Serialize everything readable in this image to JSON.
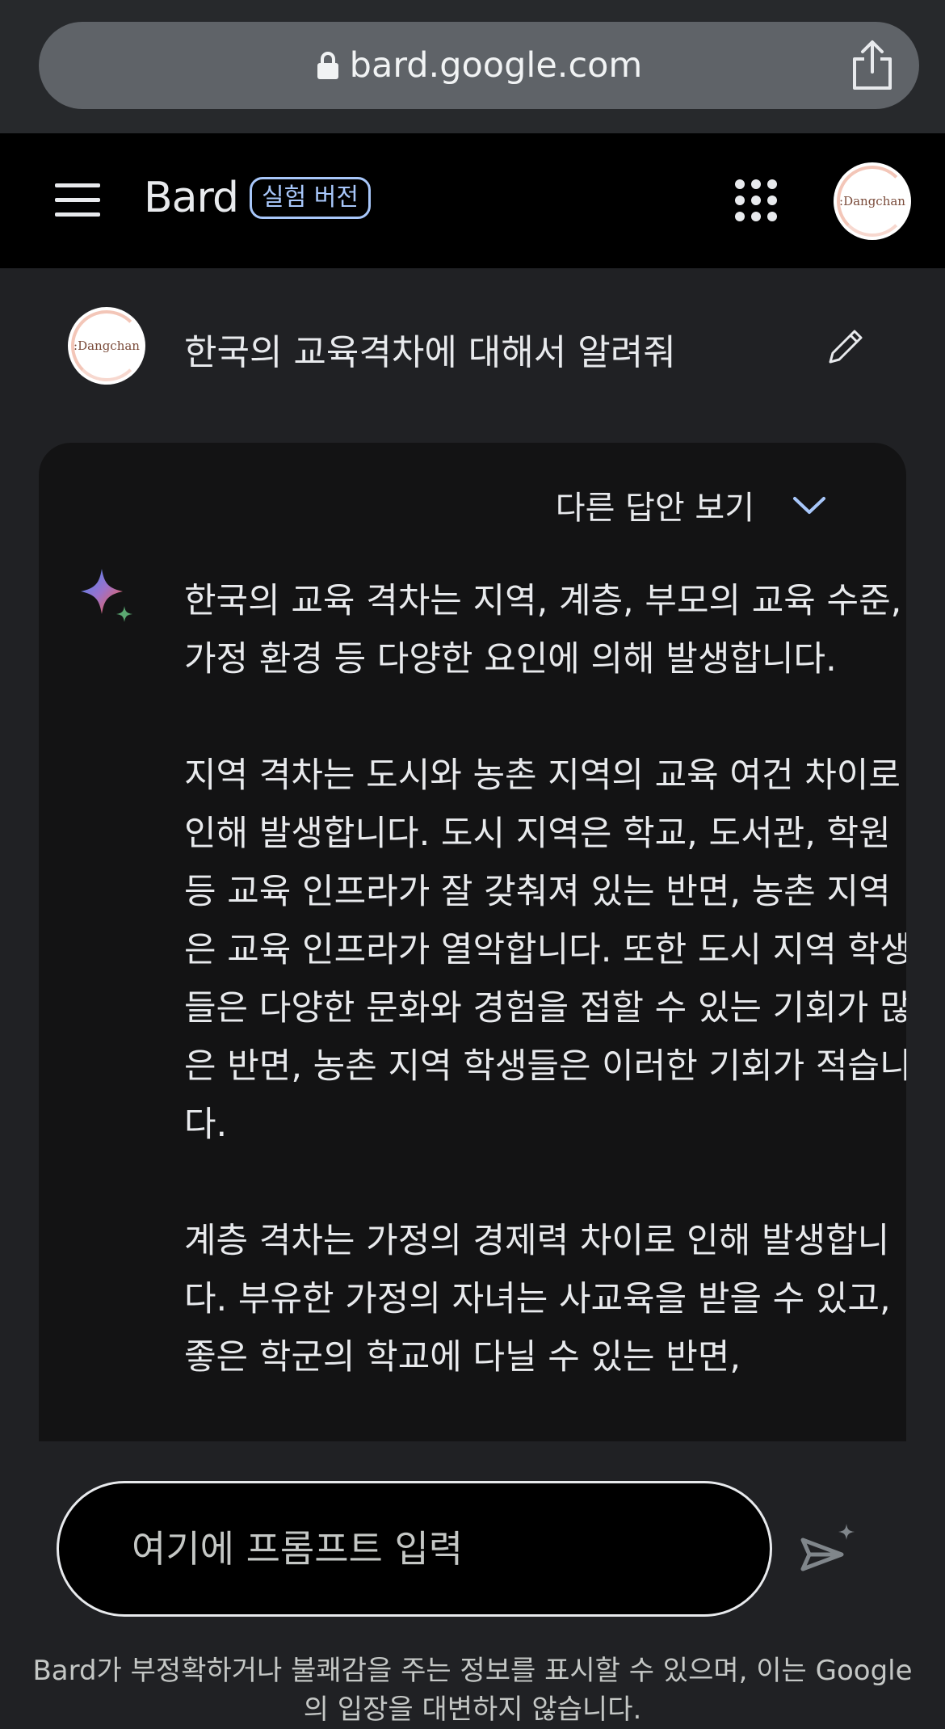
{
  "browser": {
    "url": "bard.google.com",
    "icons": {
      "lock": "lock-icon",
      "share": "share-icon"
    }
  },
  "header": {
    "brand": "Bard",
    "badge": "실험 버전",
    "icons": {
      "menu": "hamburger-menu-icon",
      "apps": "apps-grid-icon"
    },
    "avatar_label": ":Dangchan"
  },
  "conversation": {
    "user_avatar_label": ":Dangchan",
    "user_prompt": "한국의 교육격차에 대해서 알려줘",
    "drafts_label": "다른 답안 보기",
    "response_paragraphs": [
      "한국의 교육 격차는 지역, 계층, 부모의 교육 수준, 가정 환경 등 다양한 요인에 의해 발생합니다.",
      "지역 격차는 도시와 농촌 지역의 교육 여건 차이로 인해 발생합니다. 도시 지역은 학교, 도서관, 학원 등 교육 인프라가 잘 갖춰져 있는 반면, 농촌 지역은 교육 인프라가 열악합니다. 또한 도시 지역 학생들은 다양한 문화와 경험을 접할 수 있는 기회가 많은 반면, 농촌 지역 학생들은 이러한 기회가 적습니다.",
      "계층 격차는 가정의 경제력 차이로 인해 발생합니다. 부유한 가정의 자녀는 사교육을 받을 수 있고, 좋은 학군의 학교에 다닐 수 있는 반면,"
    ]
  },
  "input": {
    "placeholder": "여기에 프롬프트 입력",
    "disclaimer": "Bard가 부정확하거나 불쾌감을 주는 정보를 표시할 수 있으며, 이는 Google의 입장을 대변하지 않습니다."
  },
  "colors": {
    "background": "#202124",
    "header_bg": "#000000",
    "card_bg": "#131314",
    "accent": "#a8c7fa"
  }
}
